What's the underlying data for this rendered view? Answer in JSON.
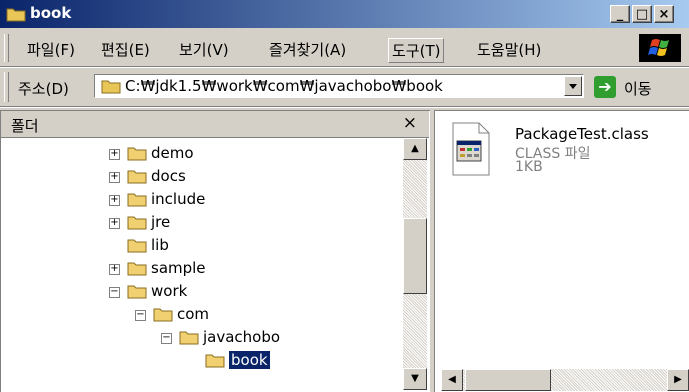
{
  "window": {
    "title": "book"
  },
  "menu": [
    {
      "label": "파일(F)"
    },
    {
      "label": "편집(E)"
    },
    {
      "label": "보기(V)"
    },
    {
      "label": "즐겨찾기(A)"
    },
    {
      "label": "도구(T)"
    },
    {
      "label": "도움말(H)"
    }
  ],
  "address": {
    "label": "주소(D)",
    "value": "C:₩jdk1.5₩work₩com₩javachobo₩book",
    "go_label": "이동"
  },
  "folder_pane": {
    "title": "폴더",
    "close_glyph": "×",
    "nodes": [
      {
        "label": "demo",
        "exp": "+"
      },
      {
        "label": "docs",
        "exp": "+"
      },
      {
        "label": "include",
        "exp": "+"
      },
      {
        "label": "jre",
        "exp": "+"
      },
      {
        "label": "lib",
        "exp": ""
      },
      {
        "label": "sample",
        "exp": "+"
      },
      {
        "label": "work",
        "exp": "−"
      },
      {
        "label": "com",
        "exp": "−"
      },
      {
        "label": "javachobo",
        "exp": "−"
      },
      {
        "label": "book",
        "exp": ""
      }
    ]
  },
  "file": {
    "name": "PackageTest.class",
    "type": "CLASS 파일",
    "size": "1KB"
  },
  "colors": {
    "title_start": "#0a246a",
    "title_end": "#a6caf0",
    "selection": "#0a246a",
    "face": "#d4d0c8"
  }
}
